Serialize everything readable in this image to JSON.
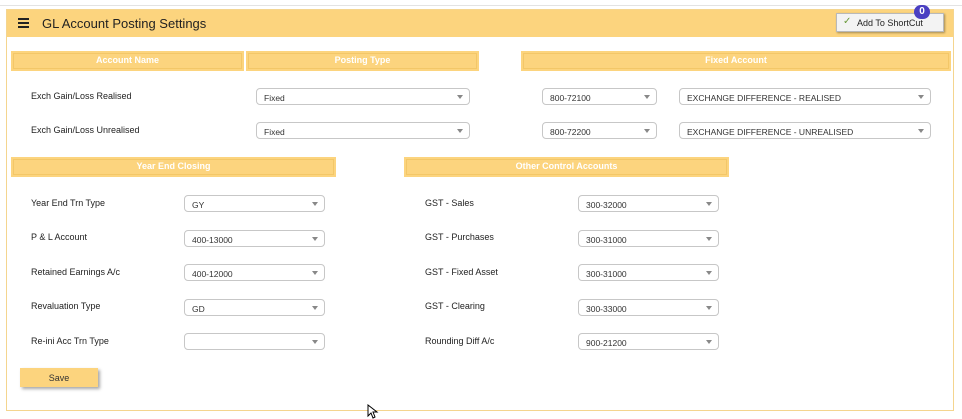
{
  "header": {
    "title": "GL Account Posting Settings",
    "shortcut_label": "Add To ShortCut",
    "shortcut_count": "0"
  },
  "sections": {
    "account_name": "Account Name",
    "posting_type": "Posting Type",
    "fixed_account": "Fixed Account",
    "year_end_closing": "Year End Closing",
    "other_control_accounts": "Other Control Accounts"
  },
  "exch_rows": [
    {
      "label": "Exch Gain/Loss Realised",
      "posting_type": "Fixed",
      "account_code": "800-72100",
      "account_desc": "EXCHANGE DIFFERENCE - REALISED"
    },
    {
      "label": "Exch Gain/Loss Unrealised",
      "posting_type": "Fixed",
      "account_code": "800-72200",
      "account_desc": "EXCHANGE DIFFERENCE - UNREALISED"
    }
  ],
  "year_end": [
    {
      "label": "Year End Trn Type",
      "value": "GY"
    },
    {
      "label": "P & L Account",
      "value": "400-13000"
    },
    {
      "label": "Retained Earnings A/c",
      "value": "400-12000"
    },
    {
      "label": "Revaluation Type",
      "value": "GD"
    },
    {
      "label": "Re-ini Acc Trn Type",
      "value": ""
    }
  ],
  "other_control": [
    {
      "label": "GST - Sales",
      "value": "300-32000"
    },
    {
      "label": "GST - Purchases",
      "value": "300-31000"
    },
    {
      "label": "GST - Fixed Asset",
      "value": "300-31000"
    },
    {
      "label": "GST - Clearing",
      "value": "300-33000"
    },
    {
      "label": "Rounding Diff A/c",
      "value": "900-21200"
    }
  ],
  "actions": {
    "save_label": "Save"
  },
  "colors": {
    "accent": "#fcd47e",
    "badge": "#4a3fc2"
  }
}
